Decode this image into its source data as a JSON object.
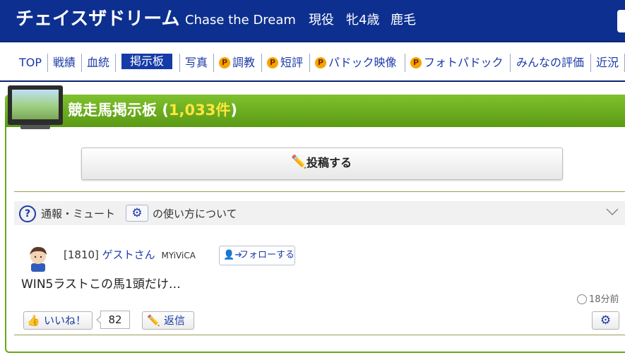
{
  "header": {
    "horse_name": "チェイスザドリーム",
    "english_name": "Chase the Dream",
    "status": "現役",
    "sex_age": "牝4歳",
    "coat_color": "鹿毛"
  },
  "nav": {
    "items": [
      {
        "label": "TOP"
      },
      {
        "label": "戦績"
      },
      {
        "label": "血統"
      },
      {
        "label": "掲示板",
        "active": true
      },
      {
        "label": "写真"
      },
      {
        "label": "調教",
        "premium": true
      },
      {
        "label": "短評",
        "premium": true
      },
      {
        "label": "パドック映像",
        "premium": true
      },
      {
        "label": "フォトパドック",
        "premium": true
      },
      {
        "label": "みんなの評価"
      },
      {
        "label": "近況"
      }
    ],
    "premium_badge": "P"
  },
  "board": {
    "title": "競走馬掲示板",
    "count_open": "(",
    "count": "1,033件",
    "count_close": ")",
    "post_button": "投稿する",
    "info": {
      "prefix": "通報・ミュート",
      "suffix": "の使い方について"
    }
  },
  "post": {
    "number": "[1810]",
    "user": "ゲストさん",
    "user_id": "MYiViCA",
    "follow_label": "フォローする",
    "body": "WIN5ラストこの馬1頭だけ…",
    "time": "18分前",
    "like_label": "いいね！",
    "like_count": "82",
    "reply_label": "返信"
  },
  "colors": {
    "header_bg": "#0d2f8f",
    "board_green": "#6aa61c",
    "count_yellow": "#ffe63a",
    "link_blue": "#1b3aa6",
    "premium_orange": "#f3a400"
  },
  "icons": {
    "post": "pencil-icon",
    "help": "question-circle-icon",
    "settings": "gear-icon",
    "expand": "chevron-down-icon",
    "follow": "follow-user-icon",
    "like": "thumbs-up-icon",
    "reply": "pencil-icon",
    "time": "clock-icon"
  }
}
